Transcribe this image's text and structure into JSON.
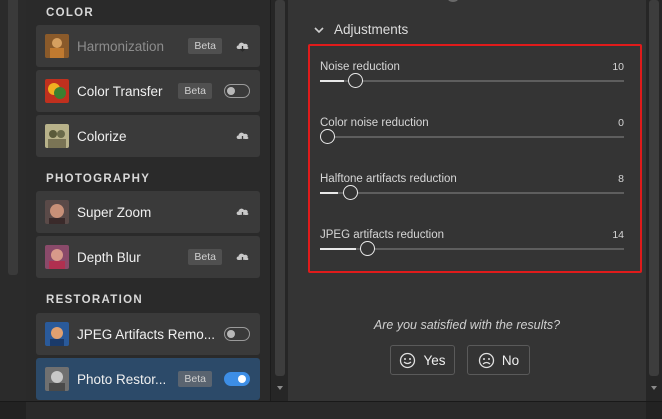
{
  "sections": [
    {
      "title": "COLOR"
    },
    {
      "title": "PHOTOGRAPHY"
    },
    {
      "title": "RESTORATION"
    }
  ],
  "filters": [
    {
      "label": "Harmonization",
      "badge": "Beta",
      "control": "cloud-download",
      "state": "disabled",
      "thumb_icon": "harmonization-thumbnail"
    },
    {
      "label": "Color Transfer",
      "badge": "Beta",
      "control": "toggle",
      "toggle_on": false,
      "thumb_icon": "color-transfer-thumbnail"
    },
    {
      "label": "Colorize",
      "badge": "",
      "control": "cloud-download",
      "thumb_icon": "colorize-thumbnail"
    },
    {
      "label": "Super Zoom",
      "badge": "",
      "control": "cloud-download",
      "thumb_icon": "super-zoom-thumbnail"
    },
    {
      "label": "Depth Blur",
      "badge": "Beta",
      "control": "cloud-download",
      "thumb_icon": "depth-blur-thumbnail"
    },
    {
      "label": "JPEG Artifacts Remo...",
      "badge": "",
      "control": "toggle",
      "toggle_on": false,
      "thumb_icon": "jpeg-artifacts-thumbnail"
    },
    {
      "label": "Photo Restor...",
      "badge": "Beta",
      "control": "toggle",
      "toggle_on": true,
      "selected": true,
      "thumb_icon": "photo-restoration-thumbnail"
    }
  ],
  "adjustments": {
    "header": "Adjustments",
    "sliders": [
      {
        "label": "Noise reduction",
        "value": "10",
        "level": 10
      },
      {
        "label": "Color noise reduction",
        "value": "0",
        "level": 0
      },
      {
        "label": "Halftone artifacts reduction",
        "value": "8",
        "level": 8
      },
      {
        "label": "JPEG artifacts reduction",
        "value": "14",
        "level": 14
      }
    ]
  },
  "feedback": {
    "question": "Are you satisfied with the results?",
    "yes_label": "Yes",
    "no_label": "No"
  },
  "colors": {
    "highlight": "#e01b1b",
    "toggle_on": "#3d8ee6",
    "selected_card": "#2c4a69"
  }
}
